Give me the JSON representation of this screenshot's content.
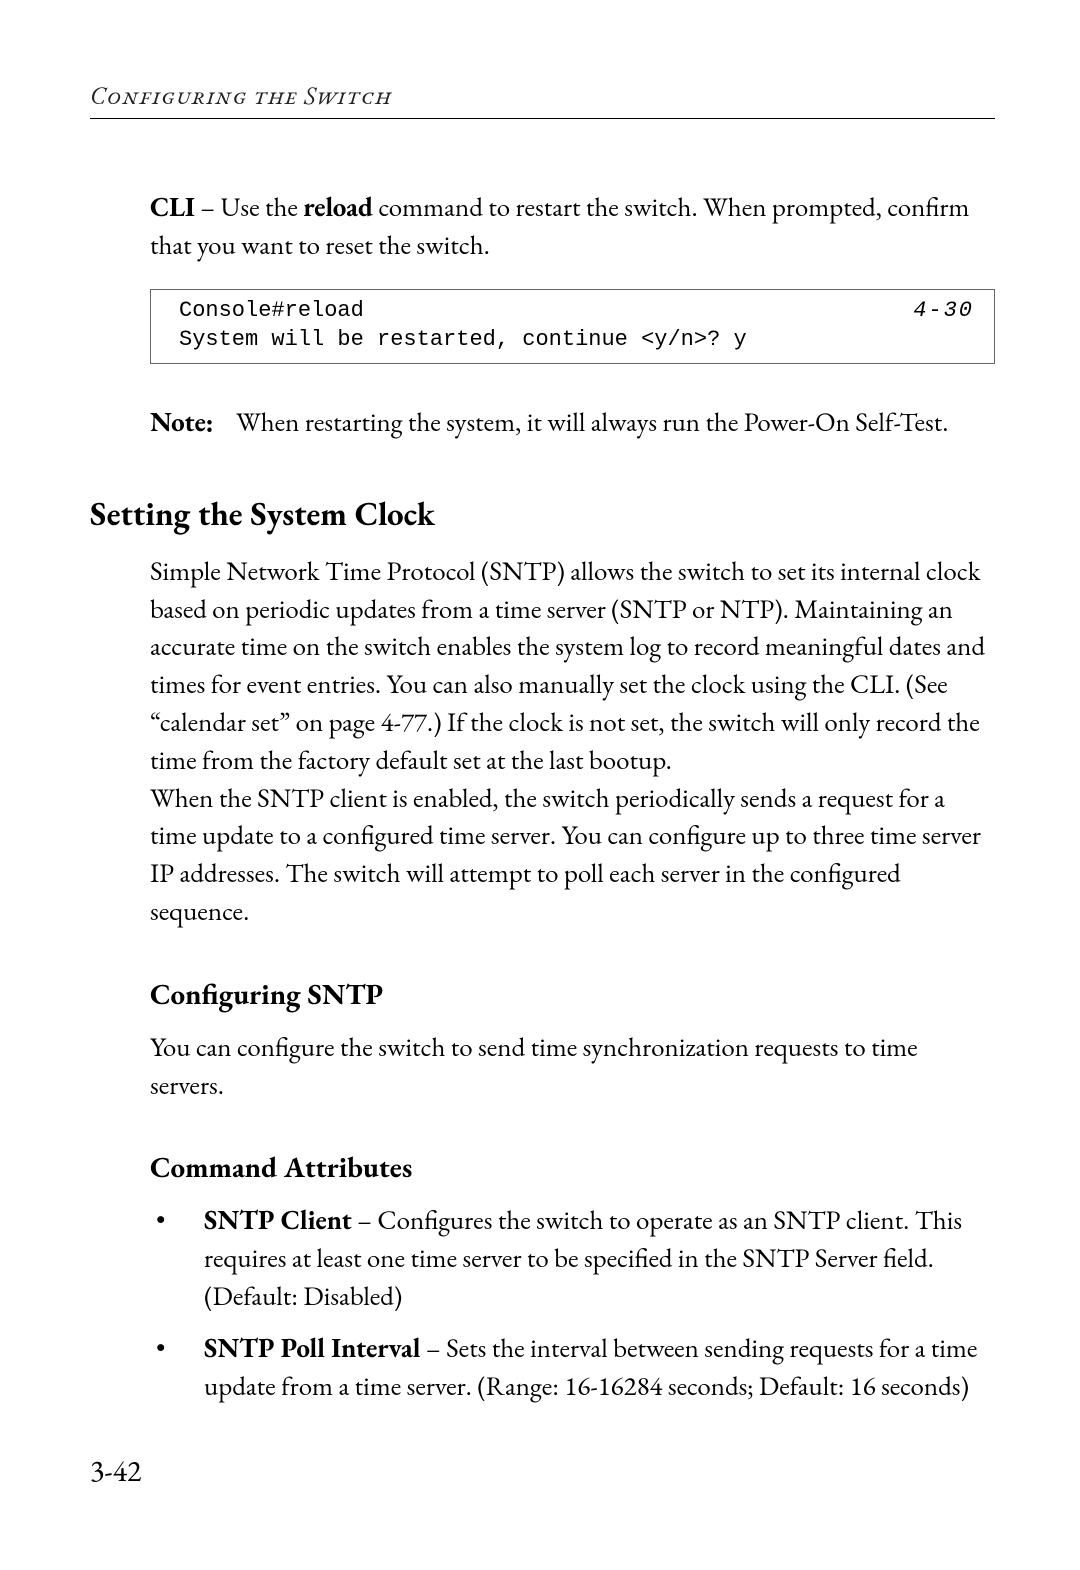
{
  "running_head": "Configuring the Switch",
  "cli_intro": {
    "label": "CLI",
    "dash": " – ",
    "pre": "Use the ",
    "cmd": "reload",
    "post": " command to restart the switch. When prompted, confirm that you want to reset the switch."
  },
  "codebox": {
    "lines": "Console#reload\nSystem will be restarted, continue <y/n>? y",
    "ref": "4-30"
  },
  "note": {
    "label": "Note:",
    "text": "When restarting the system, it will always run the Power-On Self-Test."
  },
  "section_heading": "Setting the System Clock",
  "para1": "Simple Network Time Protocol (SNTP) allows the switch to set its internal clock based on periodic updates from a time server (SNTP or NTP). Maintaining an accurate time on the switch enables the system log to record meaningful dates and times for event entries. You can also manually set the clock using the CLI. (See “calendar set” on page 4-77.) If the clock is not set, the switch will only record the time from the factory default set at the last bootup.",
  "para2": "When the SNTP client is enabled, the switch periodically sends a request for a time update to a configured time server. You can configure up to three time server IP addresses. The switch will attempt to poll each server in the configured sequence.",
  "sub1": "Configuring SNTP",
  "para3": "You can configure the switch to send time synchronization requests to time servers.",
  "sub2": "Command Attributes",
  "bullets": [
    {
      "term": "SNTP Client",
      "desc": " – Configures the switch to operate as an SNTP client. This requires at least one time server to be specified in the SNTP Server field. (Default: Disabled)"
    },
    {
      "term": "SNTP Poll Interval",
      "desc": " – Sets the interval between sending requests for a time update from a time server. (Range: 16-16284 seconds; Default: 16 seconds)"
    }
  ],
  "page_number": "3-42"
}
